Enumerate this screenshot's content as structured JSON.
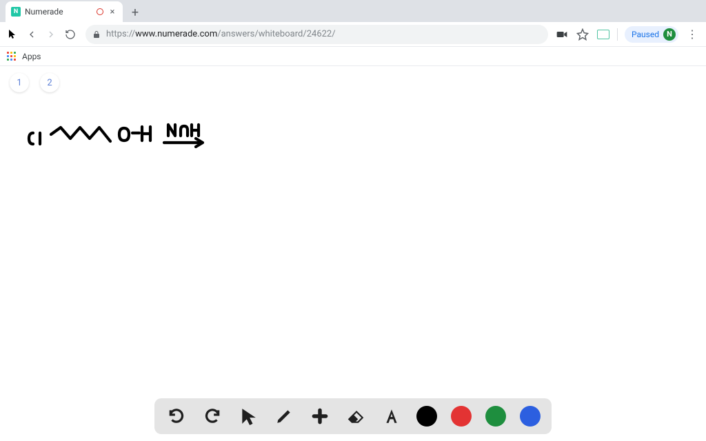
{
  "tab": {
    "title": "Numerade",
    "favicon_letter": "N"
  },
  "toolbar": {
    "url_proto": "https://",
    "url_host": "www.numerade.com",
    "url_path": "/answers/whiteboard/24622/",
    "profile_status": "Paused",
    "profile_initial": "N"
  },
  "bookmarks": {
    "apps_label": "Apps"
  },
  "pages": {
    "items": [
      "1",
      "2"
    ]
  },
  "whiteboard": {
    "colors": {
      "black": "#000000",
      "red": "#e33333",
      "green": "#1e8e3e",
      "blue": "#2c5fe0"
    }
  },
  "drawing": {
    "label_left": "Cl",
    "label_right": "O-H",
    "reagent": "NaH"
  }
}
